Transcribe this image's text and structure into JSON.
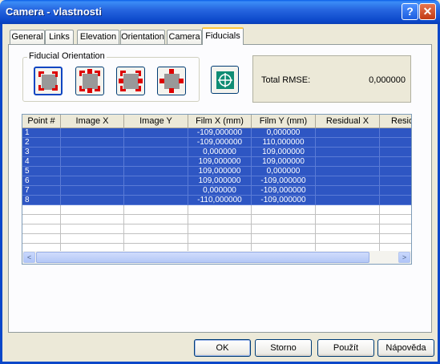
{
  "window": {
    "title": "Camera - vlastnosti",
    "help_label": "?",
    "close_label": "✕"
  },
  "tabs": [
    {
      "label": "General"
    },
    {
      "label": "Links"
    },
    {
      "label": "Elevation"
    },
    {
      "label": "Orientation"
    },
    {
      "label": "Camera"
    },
    {
      "label": "Fiducials",
      "active": true
    }
  ],
  "fiducials": {
    "group_label": "Fiducial Orientation",
    "orientation_buttons": [
      "orientation-corners-up",
      "orientation-corners-right",
      "orientation-corners-down",
      "orientation-corners-left"
    ],
    "target_icon": "crosshair-target-icon",
    "rmse_label": "Total RMSE:",
    "rmse_value": "0,000000"
  },
  "grid": {
    "columns": [
      "Point #",
      "Image X",
      "Image Y",
      "Film X (mm)",
      "Film Y (mm)",
      "Residual X",
      "Resic"
    ],
    "rows": [
      [
        "1",
        "",
        "",
        "-109,000000",
        "0,000000",
        "",
        ""
      ],
      [
        "2",
        "",
        "",
        "-109,000000",
        "110,000000",
        "",
        ""
      ],
      [
        "3",
        "",
        "",
        "0,000000",
        "109,000000",
        "",
        ""
      ],
      [
        "4",
        "",
        "",
        "109,000000",
        "109,000000",
        "",
        ""
      ],
      [
        "5",
        "",
        "",
        "109,000000",
        "0,000000",
        "",
        ""
      ],
      [
        "6",
        "",
        "",
        "109,000000",
        "-109,000000",
        "",
        ""
      ],
      [
        "7",
        "",
        "",
        "0,000000",
        "-109,000000",
        "",
        ""
      ],
      [
        "8",
        "",
        "",
        "-110,000000",
        "-109,000000",
        "",
        ""
      ]
    ],
    "selected_rows": [
      0,
      1,
      2,
      3,
      4,
      5,
      6,
      7
    ],
    "scroll_left": "<",
    "scroll_right": ">"
  },
  "buttons": {
    "ok": "OK",
    "cancel": "Storno",
    "apply": "Použít",
    "help": "Nápověda"
  },
  "colors": {
    "selection": "#2e56c3",
    "title_bar": "#0b47c9",
    "fiducial_marker": "#dd0000",
    "target_button": "#0f8c74"
  }
}
